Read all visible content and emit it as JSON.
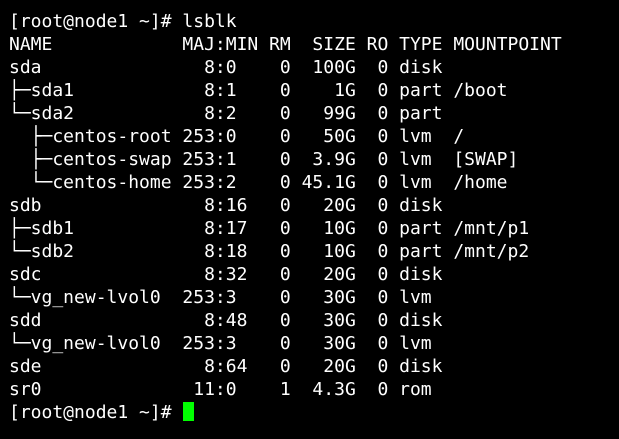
{
  "colors": {
    "background": "#000000",
    "foreground": "#ffffff",
    "cursor": "#00ff00"
  },
  "terminal": {
    "lines": [
      "[root@node1 ~]# lsblk",
      "NAME            MAJ:MIN RM  SIZE RO TYPE MOUNTPOINT",
      "sda               8:0    0  100G  0 disk",
      "├─sda1            8:1    0    1G  0 part /boot",
      "└─sda2            8:2    0   99G  0 part",
      "  ├─centos-root 253:0    0   50G  0 lvm  /",
      "  ├─centos-swap 253:1    0  3.9G  0 lvm  [SWAP]",
      "  └─centos-home 253:2    0 45.1G  0 lvm  /home",
      "sdb               8:16   0   20G  0 disk",
      "├─sdb1            8:17   0   10G  0 part /mnt/p1",
      "└─sdb2            8:18   0   10G  0 part /mnt/p2",
      "sdc               8:32   0   20G  0 disk",
      "└─vg_new-lvol0  253:3    0   30G  0 lvm",
      "sdd               8:48   0   30G  0 disk",
      "└─vg_new-lvol0  253:3    0   30G  0 lvm",
      "sde               8:64   0   20G  0 disk",
      "sr0              11:0    1  4.3G  0 rom"
    ],
    "prompt": "[root@node1 ~]# "
  }
}
